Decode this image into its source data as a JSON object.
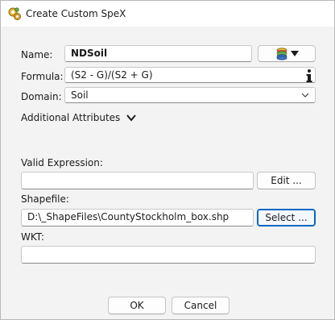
{
  "window": {
    "title": "Create Custom SpeX"
  },
  "form": {
    "name_label": "Name:",
    "name_value": "NDSoil",
    "formula_label": "Formula:",
    "formula_value": "(S2 - G)/(S2 + G)",
    "domain_label": "Domain:",
    "domain_value": "Soil",
    "additional_label": "Additional Attributes",
    "valid_label": "Valid Expression:",
    "valid_value": "",
    "edit_label": "Edit ...",
    "shapefile_label": "Shapefile:",
    "shapefile_value": "D:\\_ShapeFiles\\CountyStockholm_box.shp",
    "select_label": "Select ...",
    "wkt_label": "WKT:",
    "wkt_value": ""
  },
  "buttons": {
    "ok": "OK",
    "cancel": "Cancel"
  },
  "colors": {
    "accent": "#0067c0",
    "window_bg": "#f3f3f3"
  },
  "icons": [
    "gears-icon",
    "database-icon",
    "dropdown-arrow-icon",
    "info-icon",
    "chevron-down-icon"
  ]
}
